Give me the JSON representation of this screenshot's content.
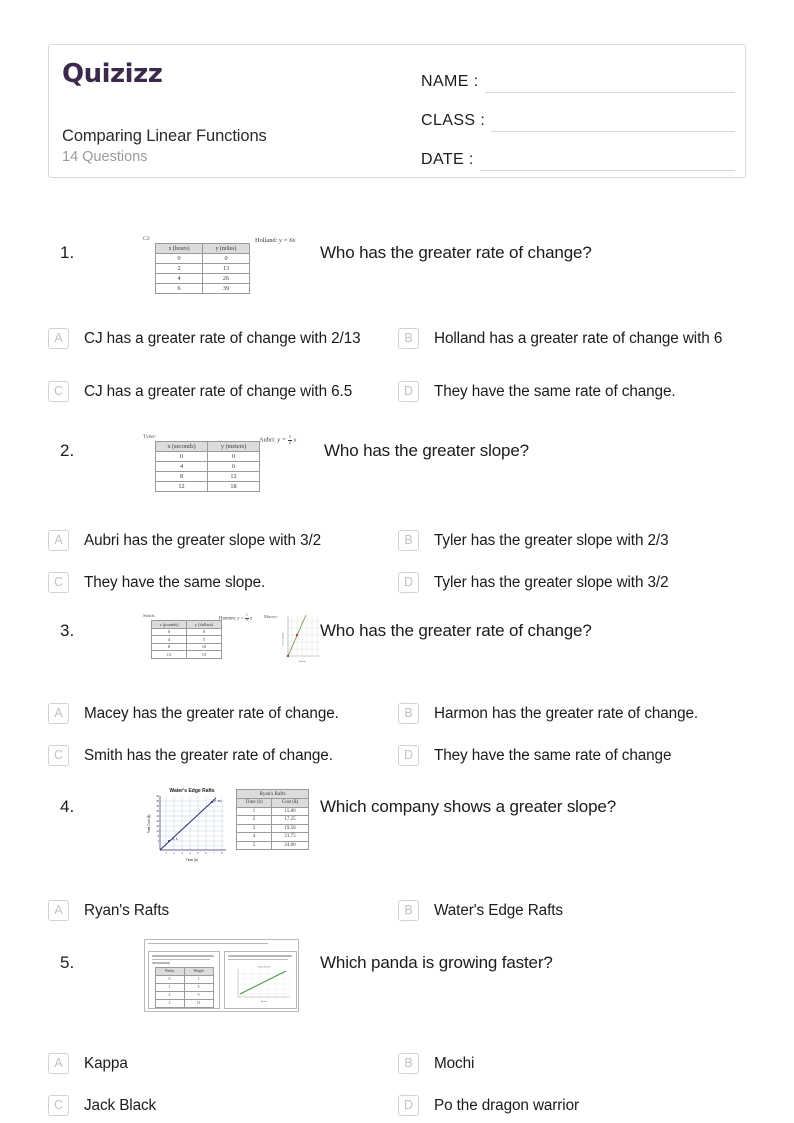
{
  "header": {
    "logo_text": "Quizizz",
    "title": "Comparing Linear Functions",
    "question_count_label": "14 Questions",
    "fields": [
      {
        "label": "NAME :"
      },
      {
        "label": "CLASS :"
      },
      {
        "label": "DATE  :"
      }
    ]
  },
  "questions": [
    {
      "number": "1.",
      "prompt": "Who has the greater rate of change?",
      "media": {
        "type": "table-and-equation",
        "table_owner": "CJ:",
        "headers": [
          "x (hours)",
          "y (miles)"
        ],
        "rows": [
          [
            "0",
            "0"
          ],
          [
            "2",
            "13"
          ],
          [
            "4",
            "26"
          ],
          [
            "6",
            "39"
          ]
        ],
        "equation_owner": "Holland:",
        "equation": "y = 6x"
      },
      "options": [
        {
          "letter": "A",
          "text": "CJ has a greater rate of change with 2/13"
        },
        {
          "letter": "B",
          "text": "Holland has a greater rate of change with 6"
        },
        {
          "letter": "C",
          "text": "CJ has a greater rate of change with 6.5"
        },
        {
          "letter": "D",
          "text": "They have the same rate of change."
        }
      ]
    },
    {
      "number": "2.",
      "prompt": "Who has the greater slope?",
      "media": {
        "type": "table-and-equation",
        "table_owner": "Tyler:",
        "headers": [
          "x (seconds)",
          "y (meters)"
        ],
        "rows": [
          [
            "0",
            "0"
          ],
          [
            "4",
            "6"
          ],
          [
            "8",
            "12"
          ],
          [
            "12",
            "18"
          ]
        ],
        "equation_owner": "Aubri:",
        "equation_numerator": "3",
        "equation_denominator": "2",
        "equation_suffix": "x"
      },
      "options": [
        {
          "letter": "A",
          "text": "Aubri has the greater slope with 3/2"
        },
        {
          "letter": "B",
          "text": "Tyler has the greater slope with 2/3"
        },
        {
          "letter": "C",
          "text": "They have the same slope."
        },
        {
          "letter": "D",
          "text": "Tyler has the greater slope with 3/2"
        }
      ]
    },
    {
      "number": "3.",
      "prompt": "Who has the greater rate of change?",
      "media": {
        "type": "table-equation-graph",
        "table_owner": "Smith:",
        "headers": [
          "x (pounds)",
          "y (dollars)"
        ],
        "rows": [
          [
            "0",
            "0"
          ],
          [
            "4",
            "5"
          ],
          [
            "8",
            "10"
          ],
          [
            "12",
            "15"
          ]
        ],
        "equation_owner": "Harmon:",
        "equation_numerator": "1",
        "equation_denominator": "2",
        "equation_suffix": "x",
        "graph_owner": "Macey:",
        "graph_ylabel": "Cost in Dollars",
        "graph_xlabel": "Pounds"
      },
      "options": [
        {
          "letter": "A",
          "text": "Macey has the greater rate of change."
        },
        {
          "letter": "B",
          "text": "Harmon has the greater rate of change."
        },
        {
          "letter": "C",
          "text": "Smith has the greater rate of change."
        },
        {
          "letter": "D",
          "text": "They have the same rate of change"
        }
      ]
    },
    {
      "number": "4.",
      "prompt": "Which company shows a greater slope?",
      "media": {
        "type": "graph-and-table",
        "graph_title": "Water's Edge Rafts",
        "graph_xlabel": "Time (h)",
        "graph_ylabel": "Total Cost ($)",
        "graph_yticks": [
          "40",
          "36",
          "32",
          "28",
          "24",
          "20",
          "16",
          "12",
          "8",
          "4"
        ],
        "graph_xticks": [
          "1",
          "2",
          "3",
          "4",
          "5",
          "6",
          "7",
          "8"
        ],
        "table_title": "Ryan's Rafts",
        "headers": [
          "Time (h)",
          "Cost ($)"
        ],
        "rows": [
          [
            "1",
            "15.00"
          ],
          [
            "2",
            "17.25"
          ],
          [
            "3",
            "19.50"
          ],
          [
            "4",
            "21.75"
          ],
          [
            "5",
            "24.00"
          ]
        ]
      },
      "options": [
        {
          "letter": "A",
          "text": "Ryan's Rafts"
        },
        {
          "letter": "B",
          "text": "Water's Edge Rafts"
        }
      ]
    },
    {
      "number": "5.",
      "prompt": "Which panda is growing faster?",
      "media": {
        "type": "document-scan",
        "headers": [
          "Weeks",
          "Weight"
        ],
        "rows": [
          [
            "0",
            "1"
          ],
          [
            "1",
            "5"
          ],
          [
            "2",
            "9"
          ],
          [
            "3",
            "13"
          ]
        ]
      },
      "options": [
        {
          "letter": "A",
          "text": "Kappa"
        },
        {
          "letter": "B",
          "text": "Mochi"
        },
        {
          "letter": "C",
          "text": "Jack Black"
        },
        {
          "letter": "D",
          "text": "Po the dragon warrior"
        }
      ]
    }
  ],
  "colors": {
    "brand": "#3c2a4d",
    "text": "#1b1b1b",
    "muted": "#9b9b9b",
    "border": "#d9d9d9",
    "option_letter": "#c2c2c2"
  }
}
